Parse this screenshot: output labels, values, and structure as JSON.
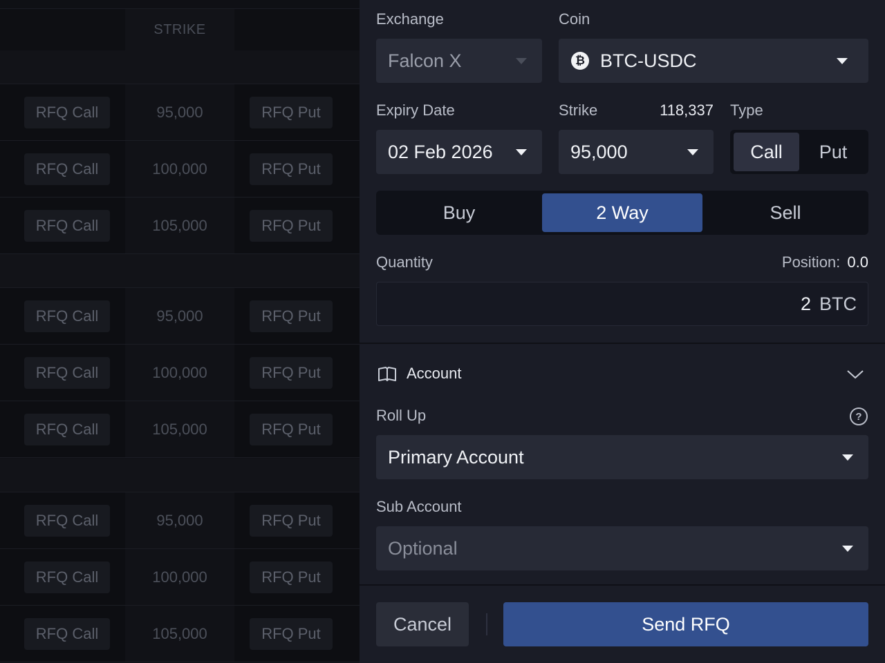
{
  "chain": {
    "header": {
      "strike_label": "STRIKE"
    },
    "groups": [
      {
        "rows": [
          {
            "call": "RFQ Call",
            "strike": "95,000",
            "put": "RFQ Put"
          },
          {
            "call": "RFQ Call",
            "strike": "100,000",
            "put": "RFQ Put"
          },
          {
            "call": "RFQ Call",
            "strike": "105,000",
            "put": "RFQ Put"
          }
        ]
      },
      {
        "rows": [
          {
            "call": "RFQ Call",
            "strike": "95,000",
            "put": "RFQ Put"
          },
          {
            "call": "RFQ Call",
            "strike": "100,000",
            "put": "RFQ Put"
          },
          {
            "call": "RFQ Call",
            "strike": "105,000",
            "put": "RFQ Put"
          }
        ]
      },
      {
        "rows": [
          {
            "call": "RFQ Call",
            "strike": "95,000",
            "put": "RFQ Put"
          },
          {
            "call": "RFQ Call",
            "strike": "100,000",
            "put": "RFQ Put"
          },
          {
            "call": "RFQ Call",
            "strike": "105,000",
            "put": "RFQ Put"
          }
        ]
      }
    ]
  },
  "rfq": {
    "exchange": {
      "label": "Exchange",
      "value": "Falcon X",
      "icon": "chevron-down-icon"
    },
    "coin": {
      "label": "Coin",
      "value": "BTC-USDC",
      "icon": "bitcoin-icon",
      "icon_glyph": "₿"
    },
    "expiry": {
      "label": "Expiry Date",
      "value": "02 Feb 2026"
    },
    "strike": {
      "label": "Strike",
      "spot": "118,337",
      "value": "95,000"
    },
    "type": {
      "label": "Type",
      "options": [
        "Call",
        "Put"
      ],
      "selected": "Call"
    },
    "side": {
      "options": [
        "Buy",
        "2 Way",
        "Sell"
      ],
      "selected": "2 Way"
    },
    "quantity": {
      "label": "Quantity",
      "position_label": "Position:",
      "position_value": "0.0",
      "value": "2",
      "unit": "BTC"
    },
    "account": {
      "title": "Account",
      "icon": "book-icon",
      "rollup_label": "Roll Up",
      "rollup_value": "Primary Account",
      "help_glyph": "?",
      "sub_label": "Sub Account",
      "sub_placeholder": "Optional"
    },
    "actions": {
      "cancel": "Cancel",
      "send": "Send RFQ"
    }
  },
  "colors": {
    "panel_bg": "#1a1c26",
    "field_bg": "#272a36",
    "accent": "#33508f",
    "chain_bg": "#0f1015"
  }
}
